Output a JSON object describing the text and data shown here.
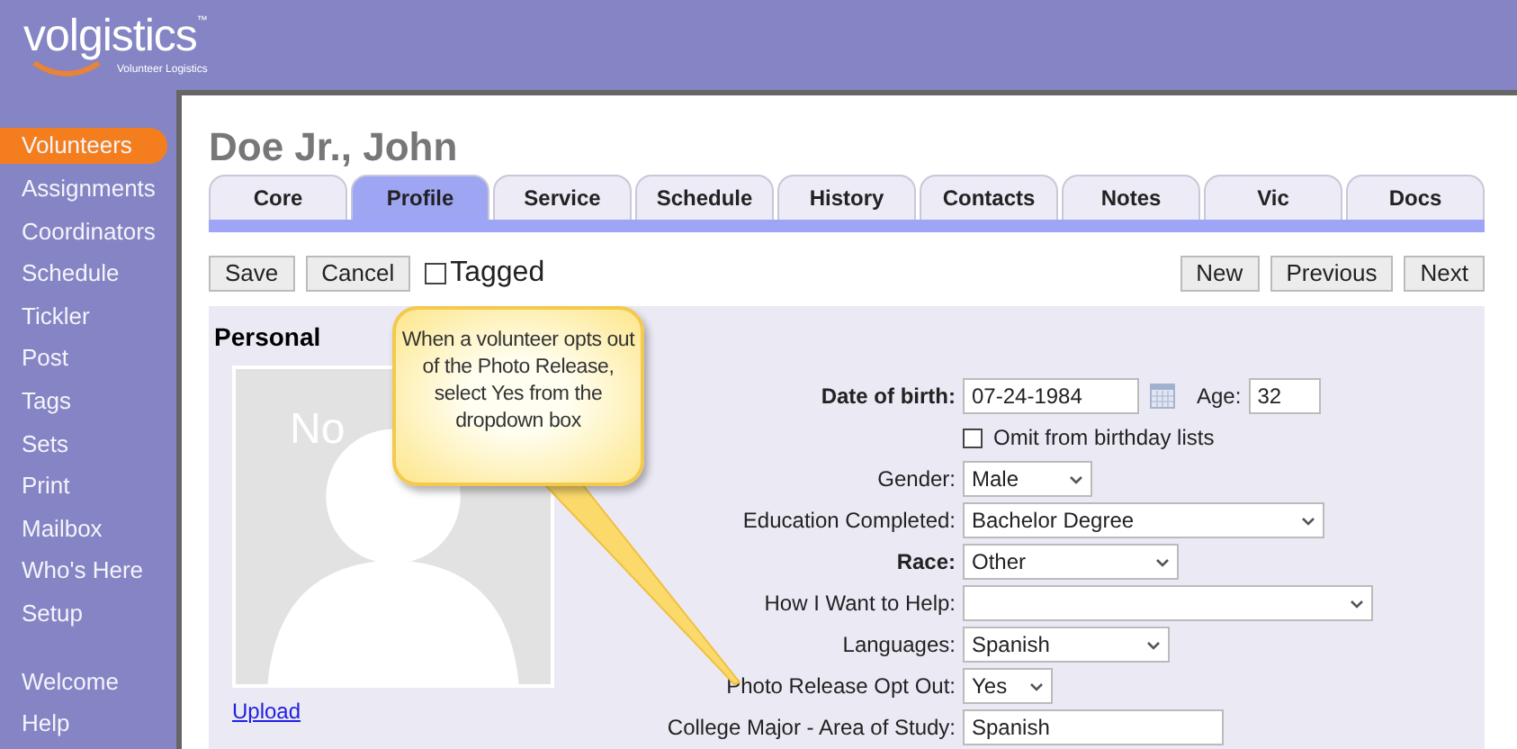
{
  "logo": {
    "name": "volgistics",
    "tm": "™",
    "tagline": "Volunteer Logistics"
  },
  "sidebar": {
    "items": [
      {
        "label": "Volunteers",
        "selected": true
      },
      {
        "label": "Assignments",
        "selected": false
      },
      {
        "label": "Coordinators",
        "selected": false
      },
      {
        "label": "Schedule",
        "selected": false
      },
      {
        "label": "Tickler",
        "selected": false
      },
      {
        "label": "Post",
        "selected": false
      },
      {
        "label": "Tags",
        "selected": false
      },
      {
        "label": "Sets",
        "selected": false
      },
      {
        "label": "Print",
        "selected": false
      },
      {
        "label": "Mailbox",
        "selected": false
      },
      {
        "label": "Who's Here",
        "selected": false
      },
      {
        "label": "Setup",
        "selected": false
      },
      {
        "label": "Welcome",
        "selected": false,
        "gap_before": true
      },
      {
        "label": "Help",
        "selected": false
      }
    ]
  },
  "title": "Doe Jr., John",
  "tabs": [
    {
      "label": "Core",
      "selected": false
    },
    {
      "label": "Profile",
      "selected": true
    },
    {
      "label": "Service",
      "selected": false
    },
    {
      "label": "Schedule",
      "selected": false
    },
    {
      "label": "History",
      "selected": false
    },
    {
      "label": "Contacts",
      "selected": false
    },
    {
      "label": "Notes",
      "selected": false
    },
    {
      "label": "Vic",
      "selected": false
    },
    {
      "label": "Docs",
      "selected": false
    }
  ],
  "toolbar": {
    "left_buttons": [
      "Save",
      "Cancel"
    ],
    "tagged": {
      "label": "Tagged",
      "checked": false
    },
    "right_buttons": [
      "New",
      "Previous",
      "Next"
    ]
  },
  "section": {
    "heading": "Personal",
    "photo": {
      "placeholder_text": "No"
    },
    "upload_link": "Upload"
  },
  "callout": "When a volunteer opts out of the Photo Release, select Yes from the dropdown box",
  "fields": [
    {
      "kind": "date",
      "label": "Date of birth:",
      "bold": true,
      "value": "07-24-1984",
      "age_label": "Age:",
      "age_value": "32"
    },
    {
      "kind": "checkbox",
      "label": "Omit from birthday lists",
      "checked": false
    },
    {
      "kind": "select",
      "label": "Gender:",
      "bold": false,
      "value": "Male"
    },
    {
      "kind": "select",
      "label": "Education Completed:",
      "bold": false,
      "value": "Bachelor Degree"
    },
    {
      "kind": "select",
      "label": "Race:",
      "bold": true,
      "value": "Other"
    },
    {
      "kind": "select",
      "label": "How I Want to Help:",
      "bold": false
    },
    {
      "kind": "select",
      "label": "Languages:",
      "bold": false,
      "value": "Spanish"
    },
    {
      "kind": "select",
      "label": "Photo Release Opt Out:",
      "bold": false,
      "value": "Yes"
    },
    {
      "kind": "text",
      "label": "College Major - Area of Study:",
      "bold": false,
      "value": "Spanish"
    }
  ]
}
